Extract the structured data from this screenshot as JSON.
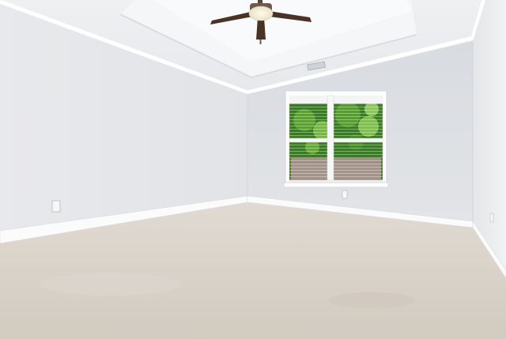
{
  "scene": {
    "kind": "empty room interior photograph",
    "elements": [
      "tray-ceiling",
      "ceiling-fan-with-light",
      "crown-molding",
      "hvac-vent",
      "double-hung-window-with-blinds",
      "trees-outside-window",
      "baseboards",
      "wall-outlets",
      "beige-carpet"
    ]
  },
  "colors": {
    "ceiling": "#eef0f2",
    "tray": "#f6f7f8",
    "left_wall": "#e4e6e9",
    "back_wall": "#dde0e4",
    "right_wall": "#eaecee",
    "trim": "#fbfbfb",
    "carpet": "#d9d2c8",
    "carpet_shadow": "#cfc7bc",
    "fan_blade": "#4a3326",
    "fan_metal": "#6d5a4a",
    "glass_light": "#f5efe0",
    "foliage": "#3f8a2e",
    "foliage_light": "#7ebb4f",
    "fence": "#9c8c82"
  }
}
